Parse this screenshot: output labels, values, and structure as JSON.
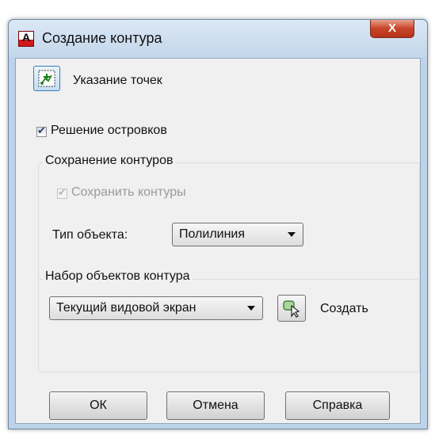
{
  "window": {
    "title": "Создание контура",
    "app_icon_letter": "A",
    "close_glyph": "X"
  },
  "pick_points": {
    "label": "Указание точек",
    "icon": "pick-points-icon"
  },
  "island_detection": {
    "label": "Решение островков",
    "checked": true
  },
  "retain_group": {
    "legend": "Сохранение контуров",
    "retain_checkbox": {
      "label": "Сохранить контуры",
      "checked": true,
      "disabled": true
    },
    "object_type_label": "Тип объекта:",
    "object_type_value": "Полилиния"
  },
  "boundary_set_group": {
    "legend": "Набор объектов контура",
    "boundary_set_value": "Текущий видовой экран",
    "new_button_label": "Создать",
    "new_button_icon": "select-objects-icon"
  },
  "buttons": {
    "ok": "ОК",
    "cancel": "Отмена",
    "help": "Справка"
  },
  "colors": {
    "title_bar": "#c3d6eb",
    "client_bg": "#f0f0f0",
    "close_button": "#c9452a"
  }
}
